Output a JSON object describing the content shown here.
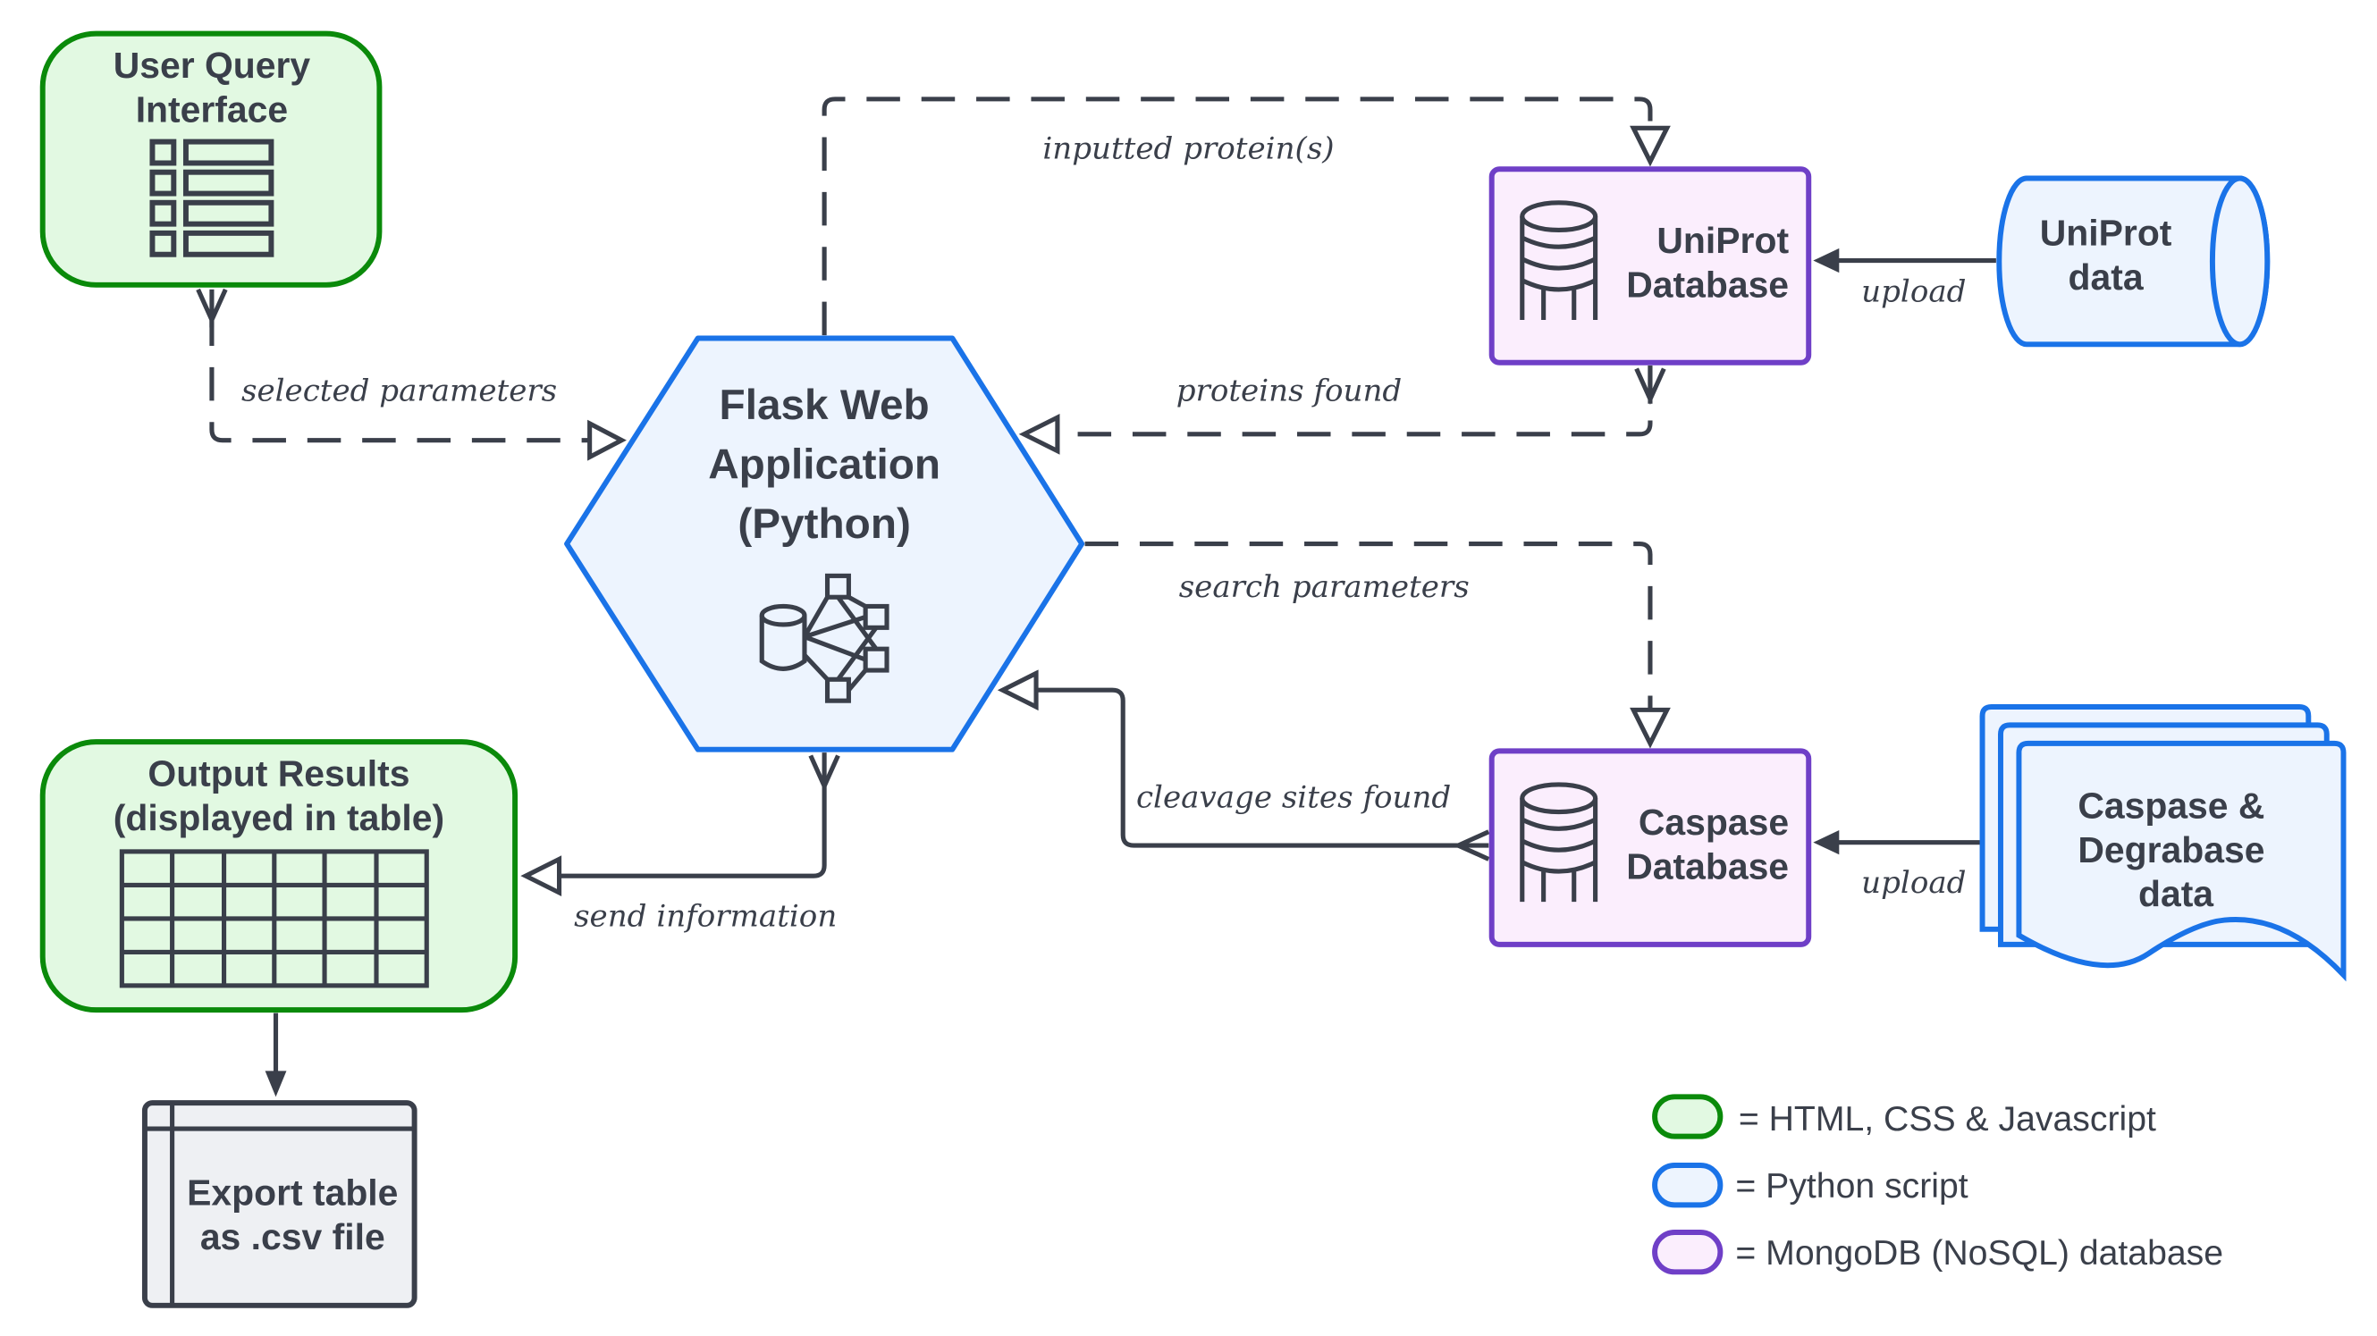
{
  "nodes": {
    "user_query": {
      "line1": "User Query",
      "line2": "Interface"
    },
    "flask": {
      "line1": "Flask Web",
      "line2": "Application",
      "line3": "(Python)"
    },
    "uniprot_db": {
      "line1": "UniProt",
      "line2": "Database"
    },
    "uniprot_data": {
      "line1": "UniProt",
      "line2": "data"
    },
    "caspase_db": {
      "line1": "Caspase",
      "line2": "Database"
    },
    "caspase_data": {
      "line1": "Caspase &",
      "line2": "Degrabase",
      "line3": "data"
    },
    "output": {
      "line1": "Output Results",
      "line2": "(displayed in table)"
    },
    "export": {
      "line1": "Export table",
      "line2": "as .csv file"
    }
  },
  "edges": {
    "selected_parameters": "selected parameters",
    "inputted_proteins": "inputted protein(s)",
    "proteins_found": "proteins found",
    "upload_uniprot": "upload",
    "search_parameters": "search parameters",
    "cleavage_sites_found": "cleavage sites found",
    "upload_caspase": "upload",
    "send_information": "send information"
  },
  "legend": [
    {
      "label": "= HTML, CSS & Javascript",
      "stroke": "#0a8a0a",
      "fill": "#e2f9e2"
    },
    {
      "label": "= Python script",
      "stroke": "#1a73e8",
      "fill": "#edf4fe"
    },
    {
      "label": "= MongoDB (NoSQL) database",
      "stroke": "#6f3fc7",
      "fill": "#fbeefd"
    }
  ],
  "colors": {
    "text": "#3a3f4a",
    "green": "#0a8a0a",
    "blue": "#1a73e8",
    "purple": "#6f3fc7"
  }
}
